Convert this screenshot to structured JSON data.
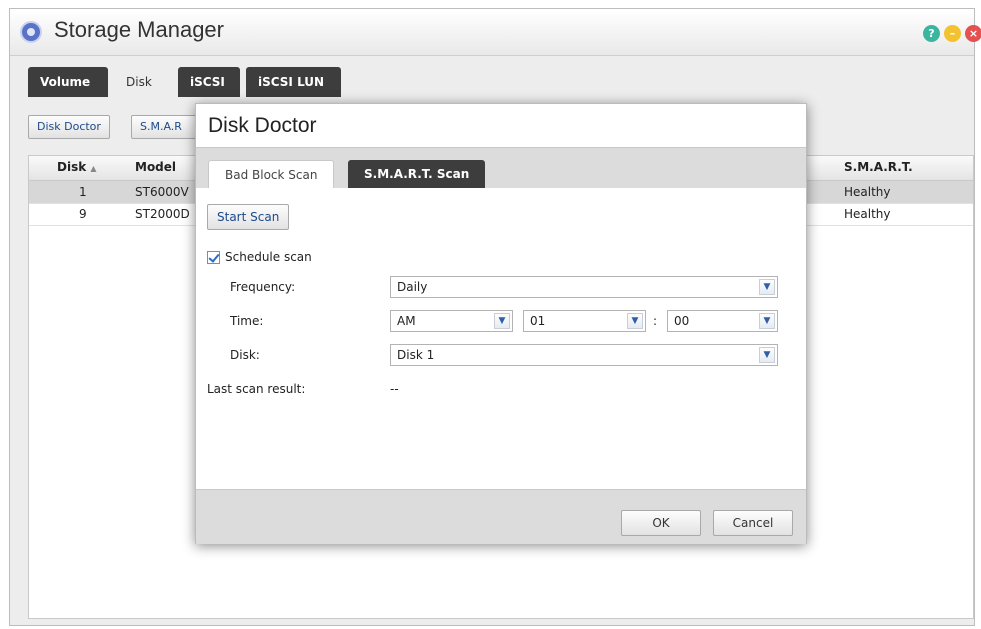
{
  "window": {
    "title": "Storage Manager",
    "controls": [
      "help-icon",
      "minimize-icon",
      "close-icon"
    ]
  },
  "tabs": [
    {
      "label": "Volume"
    },
    {
      "label": "Disk"
    },
    {
      "label": "iSCSI"
    },
    {
      "label": "iSCSI LUN"
    }
  ],
  "toolbar": {
    "disk_doctor": "Disk Doctor",
    "smart": "S.M.A.R"
  },
  "grid": {
    "columns": {
      "disk": "Disk",
      "model": "Model",
      "smart": "S.M.A.R.T."
    },
    "rows": [
      {
        "disk": "1",
        "model": "ST6000V",
        "smart": "Healthy"
      },
      {
        "disk": "9",
        "model": "ST2000D",
        "smart": "Healthy"
      }
    ]
  },
  "dialog": {
    "title": "Disk Doctor",
    "tabs": {
      "bad_block": "Bad Block Scan",
      "smart_scan": "S.M.A.R.T. Scan"
    },
    "start_scan": "Start Scan",
    "schedule_label": "Schedule scan",
    "frequency_label": "Frequency:",
    "frequency_value": "Daily",
    "time_label": "Time:",
    "ampm_value": "AM",
    "hour_value": "01",
    "time_sep": ":",
    "minute_value": "00",
    "disk_label": "Disk:",
    "disk_value": "Disk 1",
    "last_result_label": "Last scan result:",
    "last_result_value": "--",
    "ok": "OK",
    "cancel": "Cancel"
  }
}
